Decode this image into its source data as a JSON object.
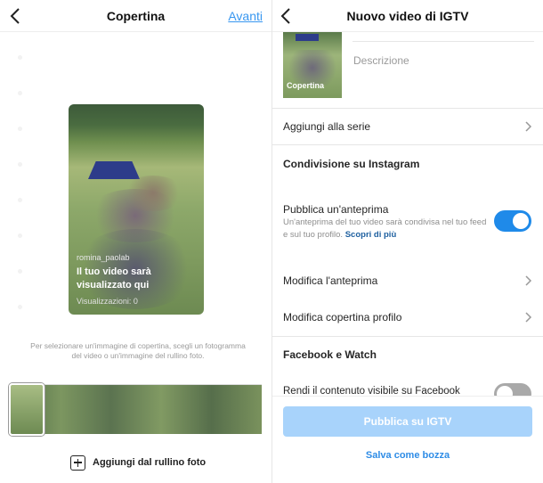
{
  "left": {
    "header": {
      "title": "Copertina",
      "next_label": "Avanti"
    },
    "preview": {
      "username": "romina_paolab",
      "message": "Il tuo video sarà visualizzato qui",
      "views": "Visualizzazioni: 0"
    },
    "hint": "Per selezionare un'immagine di copertina, scegli un fotogramma del video o un'immagine del rullino foto.",
    "add_from_roll": "Aggiungi dal rullino foto"
  },
  "right": {
    "header": {
      "title": "Nuovo video di IGTV"
    },
    "cover_label": "Copertina",
    "description_placeholder": "Descrizione",
    "add_to_series": "Aggiungi alla serie",
    "instagram_section": "Condivisione su Instagram",
    "preview_toggle": {
      "title": "Pubblica un'anteprima",
      "subtitle": "Un'anteprima del tuo video sarà condivisa nel tuo feed e sul tuo profilo.",
      "link": "Scopri di più",
      "on": true
    },
    "edit_preview": "Modifica l'anteprima",
    "edit_profile_cover": "Modifica copertina profilo",
    "facebook_section": "Facebook e Watch",
    "facebook_row": "Rendi il contenuto visibile su Facebook",
    "facebook_on": false,
    "publish_button": "Pubblica su IGTV",
    "save_draft": "Salva come bozza"
  },
  "colors": {
    "accent": "#3897f0",
    "toggle_on": "#1f8ae9",
    "publish_disabled": "#a8d3fb",
    "link": "#1d5f9f"
  }
}
